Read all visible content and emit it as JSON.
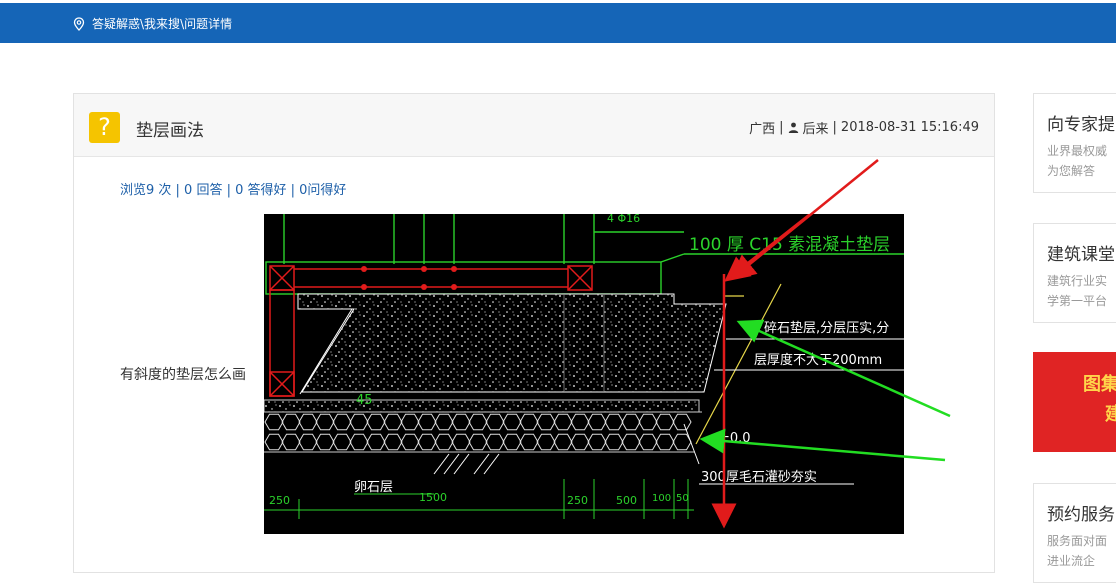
{
  "breadcrumb": {
    "items": [
      "答疑解惑",
      "\\我来搜",
      "\\问题详情"
    ]
  },
  "question": {
    "badge": "?",
    "title": "垫层画法",
    "region": "广西",
    "sep1": "|",
    "author": "后来",
    "sep2": "|",
    "datetime": "2018-08-31 15:16:49",
    "stats": "浏览9 次 | 0 回答 | 0 答得好 | 0问得好",
    "body": "有斜度的垫层怎么画"
  },
  "drawing": {
    "labels": {
      "top_rebar": "4 Φ16",
      "concrete": "100  厚 C15  素混凝土垫层",
      "gravel_1": "碎石垫层,分层压实,分",
      "gravel_2": "层厚度不大于200mm",
      "angle": "45",
      "elevation": "±0.0",
      "rubble": "300厚毛石灌砂夯实",
      "pebble": "卵石层",
      "dims": [
        "250",
        "1500",
        "250",
        "500",
        "100",
        "50"
      ]
    },
    "colors": {
      "line": "#2bd22b",
      "red_arrow": "#e11b1b",
      "green_arrow": "#22dd22",
      "gravel_fill": "#ffffff",
      "background": "#000000"
    }
  },
  "sidebar": {
    "card1": {
      "title": "向专家提",
      "line1": "业界最权威",
      "line2": "为您解答"
    },
    "card2": {
      "title": "建筑课堂",
      "line1": "建筑行业实",
      "line2": "学第一平台"
    },
    "promo": {
      "line1": "图集",
      "line2": "建"
    },
    "card3": {
      "title": "预约服务",
      "line1": "服务面对面",
      "line2": "进业流企"
    }
  },
  "colors": {
    "topbar": "#1565b7",
    "badge": "#f5c400",
    "link": "#1d5fa8"
  }
}
